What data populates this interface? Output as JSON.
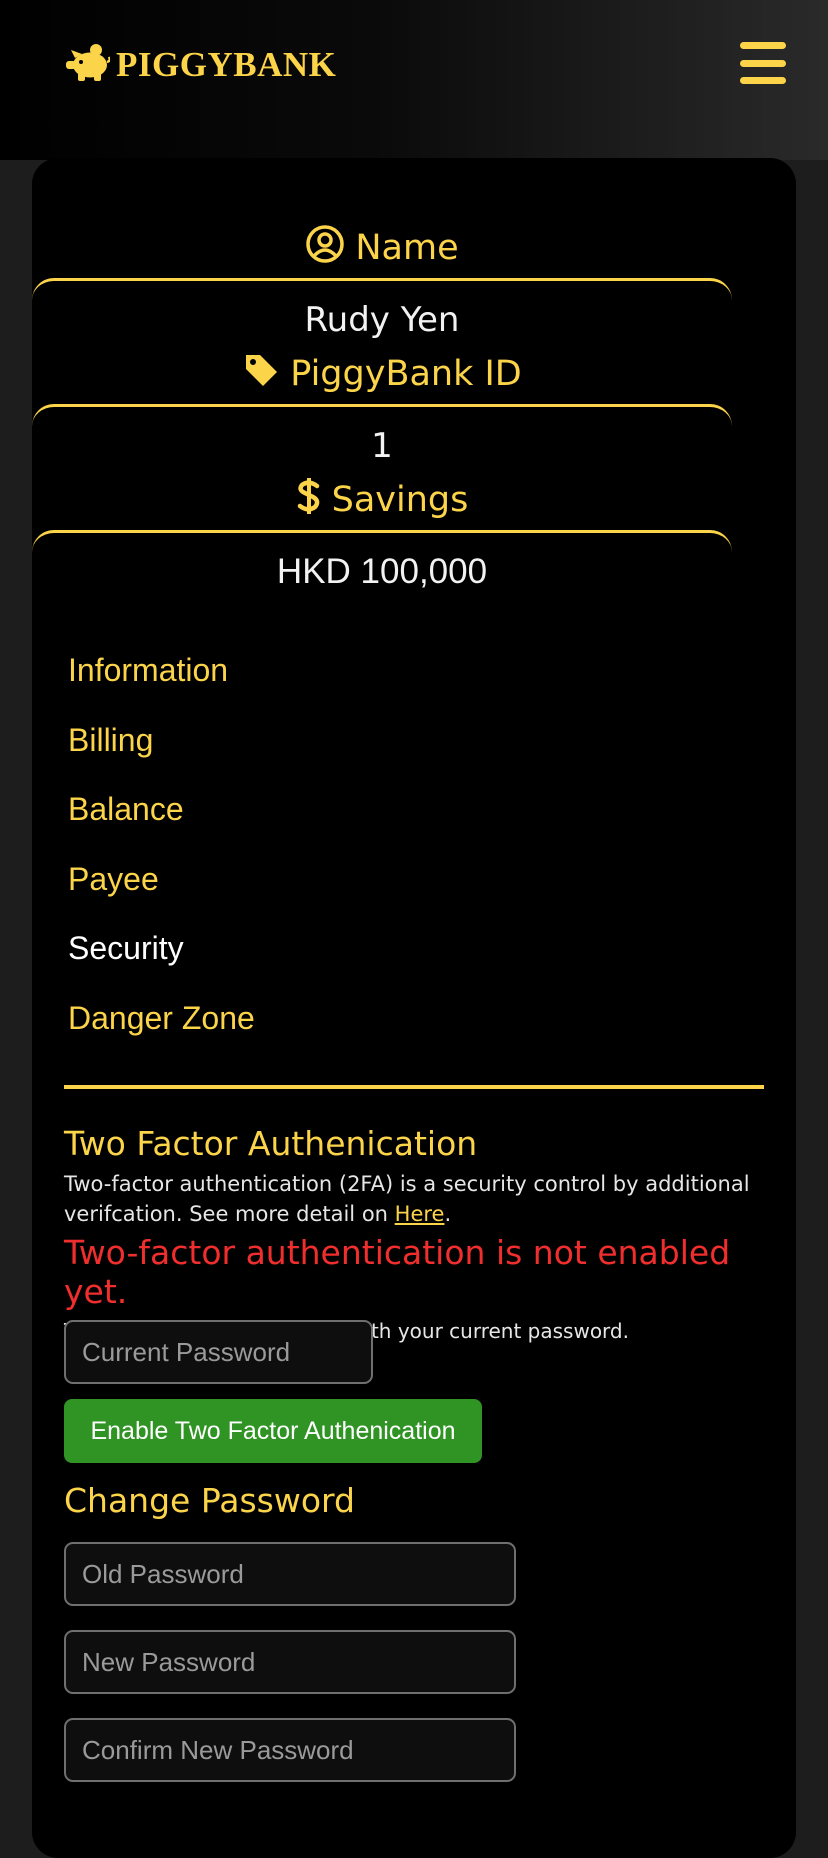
{
  "header": {
    "brand": "PIGGYBANK",
    "menu_icon": "hamburger-icon"
  },
  "profile": {
    "name_label": "Name",
    "name_value": "Rudy Yen",
    "id_label": "PiggyBank ID",
    "id_value": "1",
    "savings_label": "Savings",
    "savings_value": "HKD 100,000"
  },
  "nav": {
    "items": [
      {
        "label": "Information",
        "active": false
      },
      {
        "label": "Billing",
        "active": false
      },
      {
        "label": "Balance",
        "active": false
      },
      {
        "label": "Payee",
        "active": false
      },
      {
        "label": "Security",
        "active": true
      },
      {
        "label": "Danger Zone",
        "active": false
      }
    ]
  },
  "twofa": {
    "title": "Two Factor Authenication",
    "desc_before_link": "Two-factor authentication (2FA) is a security control by additional verifcation. See more detail on ",
    "link": "Here",
    "desc_after_link": ".",
    "warning": "Two-factor authentication is not enabled yet.",
    "instruction": "To enable 2FA, please verify with your current password.",
    "password_placeholder": "Current Password",
    "button": "Enable Two Factor Authenication"
  },
  "change_password": {
    "title": "Change Password",
    "old_placeholder": "Old Password",
    "new_placeholder": "New Password",
    "confirm_placeholder": "Confirm New Password"
  },
  "colors": {
    "accent": "#fcd44a",
    "warning": "#f02e2e",
    "button_green": "#2f9424",
    "background": "#000000"
  }
}
